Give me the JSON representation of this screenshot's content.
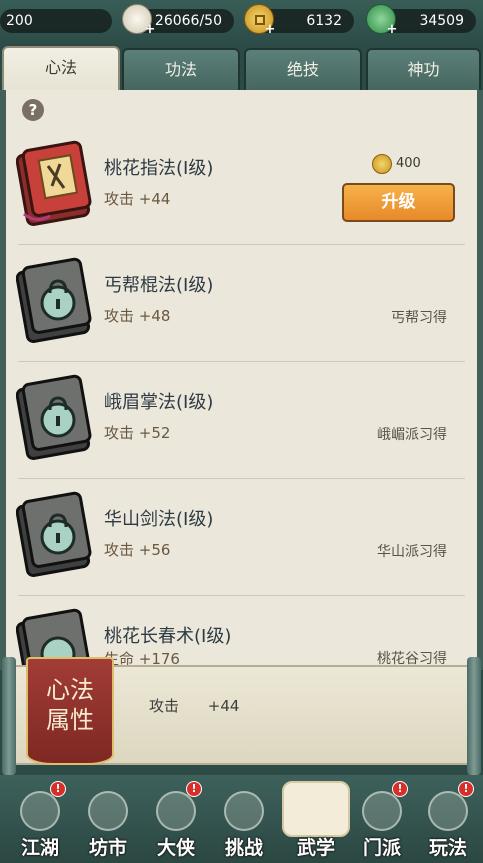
{
  "resources": {
    "level": "200",
    "stamina": "26066/50",
    "copper": "6132",
    "jade": "34509"
  },
  "tabs": [
    {
      "label": "心法"
    },
    {
      "label": "功法"
    },
    {
      "label": "绝技"
    },
    {
      "label": "神功"
    }
  ],
  "items": [
    {
      "name": "桃花指法(I级)",
      "stat": "攻击 +44",
      "cost": "400",
      "button": "升级",
      "locked": false
    },
    {
      "name": "丐帮棍法(I级)",
      "stat": "攻击 +48",
      "source": "丐帮习得",
      "locked": true
    },
    {
      "name": "峨眉掌法(I级)",
      "stat": "攻击 +52",
      "source": "峨嵋派习得",
      "locked": true
    },
    {
      "name": "华山剑法(I级)",
      "stat": "攻击 +56",
      "source": "华山派习得",
      "locked": true
    },
    {
      "name": "桃花长春术(I级)",
      "stat": "生命 +176",
      "source": "桃花谷习得",
      "locked": true
    }
  ],
  "attributes": {
    "badge_line1": "心法",
    "badge_line2": "属性",
    "attr_name": "攻击",
    "attr_value": "+44"
  },
  "nav": [
    {
      "label": "江湖",
      "badge": true
    },
    {
      "label": "坊市",
      "badge": false
    },
    {
      "label": "大侠",
      "badge": true
    },
    {
      "label": "挑战",
      "badge": false
    },
    {
      "label": "武学",
      "badge": false,
      "active": true
    },
    {
      "label": "门派",
      "badge": true
    },
    {
      "label": "玩法",
      "badge": true
    }
  ],
  "colors": {
    "upgrade_button": "#f0a23c",
    "badge": "#d7302a",
    "attr_badge": "#9a352f",
    "panel": "#ebe8db",
    "frame": "#2c4a46"
  }
}
